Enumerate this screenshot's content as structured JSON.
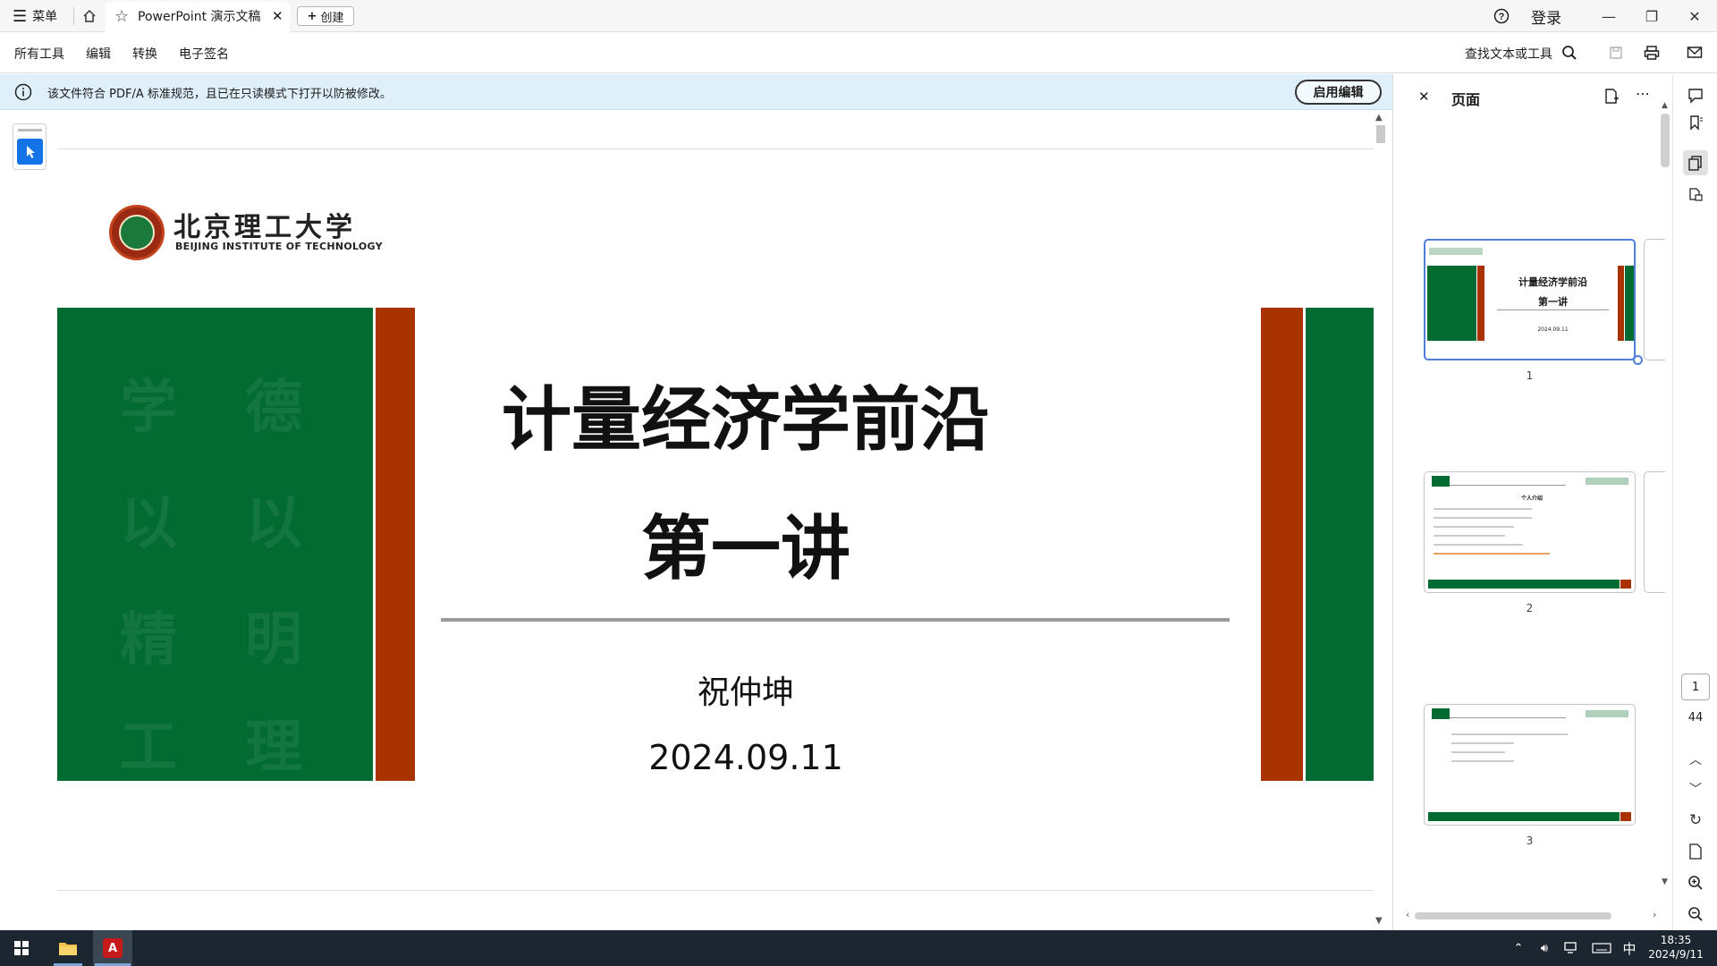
{
  "titlebar": {
    "menu_label": "菜单",
    "tab_title": "PowerPoint 演示文稿",
    "create_label": "创建",
    "login_label": "登录"
  },
  "menubar": {
    "items": [
      "所有工具",
      "编辑",
      "转换",
      "电子签名"
    ],
    "search_label": "查找文本或工具"
  },
  "notice": {
    "text": "该文件符合 PDF/A 标准规范，且已在只读模式下打开以防被修改。",
    "button_label": "启用编辑"
  },
  "slide": {
    "logo_cn": "北京理工大学",
    "logo_en": "BEIJING INSTITUTE OF TECHNOLOGY",
    "title": "计量经济学前沿",
    "subtitle": "第一讲",
    "author": "祝仲坤",
    "date": "2024.09.11",
    "colors": {
      "green": "#026b31",
      "red": "#a83200"
    }
  },
  "panel": {
    "title": "页面",
    "thumbnails": [
      {
        "number": "1",
        "title": "计量经济学前沿",
        "subtitle": "第一讲",
        "date": "2024.09.11"
      },
      {
        "number": "2",
        "title": "个人介绍"
      },
      {
        "number": "3"
      }
    ]
  },
  "pager": {
    "current": "1",
    "total": "44"
  },
  "taskbar": {
    "ime": "中",
    "time": "18:35",
    "date": "2024/9/11"
  }
}
